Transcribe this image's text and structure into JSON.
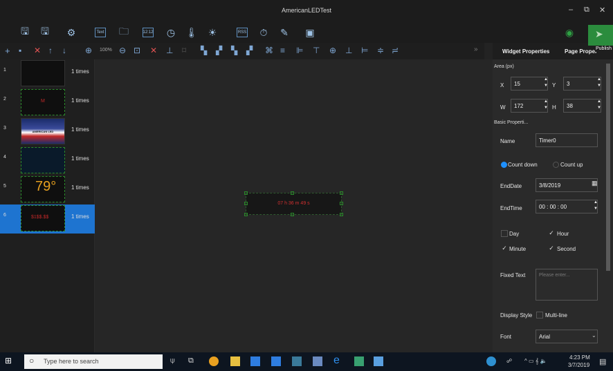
{
  "window": {
    "title": "AmericanLEDTest"
  },
  "toolbar2": {
    "zoom": "100%"
  },
  "programs": [
    {
      "num": "1",
      "times": "1 times",
      "thumb": ""
    },
    {
      "num": "2",
      "times": "1 times",
      "thumb": "M"
    },
    {
      "num": "3",
      "times": "1 times",
      "thumb": "AMERICAN LED"
    },
    {
      "num": "4",
      "times": "1 times",
      "thumb": ""
    },
    {
      "num": "5",
      "times": "1 times",
      "thumb": "79°"
    },
    {
      "num": "6",
      "times": "1 times",
      "thumb": "$1$$.$$"
    }
  ],
  "canvas": {
    "led_text": "07 h 36 m 49 s"
  },
  "right_panel": {
    "tab_widget": "Widget Properties",
    "tab_page": "Page Proper",
    "publish": "Publish",
    "area_label": "Area (px)",
    "x_label": "X",
    "x_value": "15",
    "y_label": "Y",
    "y_value": "3",
    "w_label": "W",
    "w_value": "172",
    "h_label": "H",
    "h_value": "38",
    "basic_label": "Basic Properti...",
    "name_label": "Name",
    "name_value": "Timer0",
    "count_down": "Count down",
    "count_up": "Count up",
    "enddate_label": "EndDate",
    "enddate_value": "3/8/2019",
    "endtime_label": "EndTime",
    "endtime_value": "00 : 00 : 00",
    "day": "Day",
    "hour": "Hour",
    "minute": "Minute",
    "second": "Second",
    "fixed_text_label": "Fixed Text",
    "fixed_text_placeholder": "Please enter...",
    "display_style_label": "Display Style",
    "multiline": "Multi-line",
    "font_label": "Font",
    "font_value": "Arial"
  },
  "taskbar": {
    "search_placeholder": "Type here to search",
    "time": "4:23 PM",
    "date": "3/7/2019"
  },
  "colors": {
    "accent": "#1e74d0",
    "led_red": "#d03030",
    "publish_green": "#2ea043"
  }
}
